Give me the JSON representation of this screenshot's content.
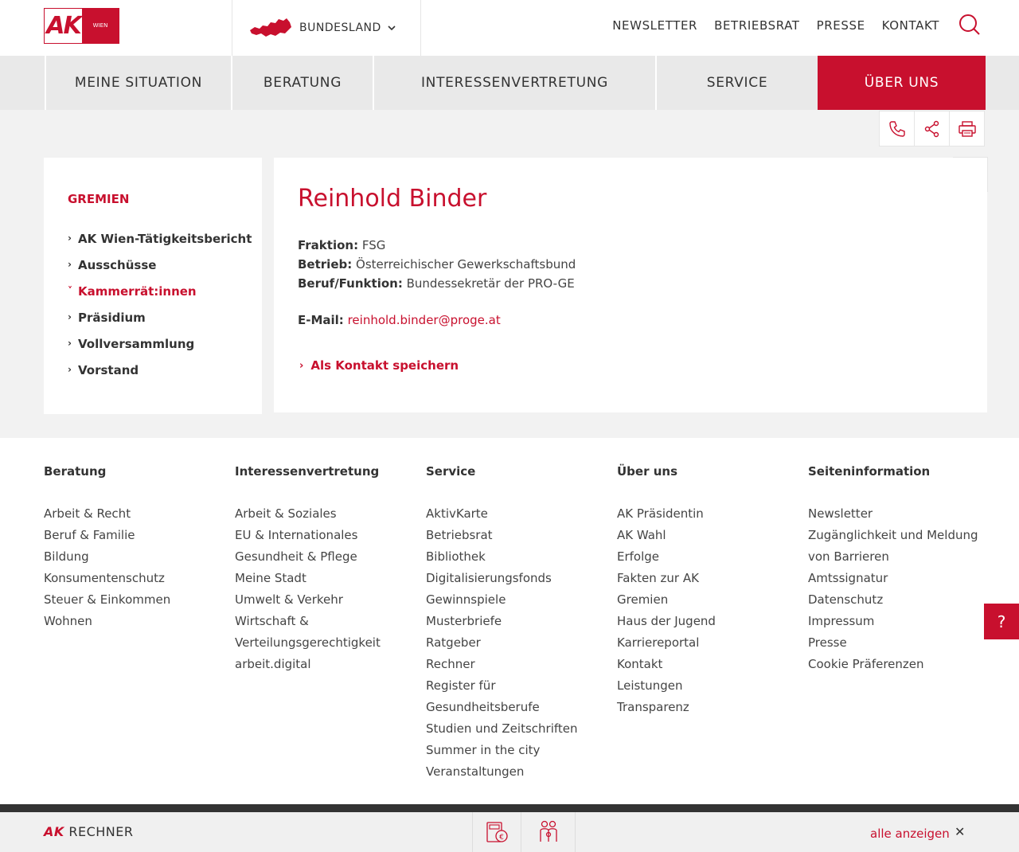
{
  "header": {
    "logo": {
      "ak": "AK",
      "wien": "WIEN"
    },
    "bundesland_label": "BUNDESLAND",
    "top_links": [
      "NEWSLETTER",
      "BETRIEBSRAT",
      "PRESSE",
      "KONTAKT"
    ]
  },
  "main_nav": {
    "items": [
      "MEINE SITUATION",
      "BERATUNG",
      "INTERESSENVERTRETUNG",
      "SERVICE",
      "ÜBER UNS"
    ],
    "active": "ÜBER UNS"
  },
  "sidebar": {
    "title": "GREMIEN",
    "items": [
      {
        "label": "AK Wien-Tätigkeitsbericht",
        "active": false
      },
      {
        "label": "Ausschüsse",
        "active": false
      },
      {
        "label": "Kammerrät:innen",
        "active": true
      },
      {
        "label": "Präsidium",
        "active": false
      },
      {
        "label": "Vollversammlung",
        "active": false
      },
      {
        "label": "Vorstand",
        "active": false
      }
    ]
  },
  "profile": {
    "name": "Reinhold Binder",
    "fraktion_label": "Fraktion:",
    "fraktion": "FSG",
    "betrieb_label": "Betrieb:",
    "betrieb": "Österreichischer Gewerkschaftsbund",
    "beruf_label": "Beruf/Funktion:",
    "beruf": "Bundessekretär der PRO-GE",
    "email_label": "E-Mail:",
    "email": "reinhold.binder@proge.at",
    "save_contact": "Als Kontakt speichern"
  },
  "footer": {
    "columns": [
      {
        "title": "Beratung",
        "links": [
          "Arbeit & Recht",
          "Beruf & Familie",
          "Bildung",
          "Konsumentenschutz",
          "Steuer & Einkommen",
          "Wohnen"
        ]
      },
      {
        "title": "Interessenvertretung",
        "links": [
          "Arbeit & Soziales",
          "EU & Internationales",
          "Gesundheit & Pflege",
          "Meine Stadt",
          "Umwelt & Verkehr",
          "Wirtschaft &",
          "Verteilungsgerechtigkeit",
          "arbeit.digital"
        ]
      },
      {
        "title": "Service",
        "links": [
          "AktivKarte",
          "Betriebsrat",
          "Bibliothek",
          "Digitalisierungsfonds",
          "Gewinnspiele",
          "Musterbriefe",
          "Ratgeber",
          "Rechner",
          "Register für",
          "Gesundheitsberufe",
          "Studien und Zeitschriften",
          "Summer in the city",
          "Veranstaltungen"
        ]
      },
      {
        "title": "Über uns",
        "links": [
          "AK Präsidentin",
          "AK Wahl",
          "Erfolge",
          "Fakten zur AK",
          "Gremien",
          "Haus der Jugend",
          "Karriereportal",
          "Kontakt",
          "Leistungen",
          "Transparenz"
        ]
      },
      {
        "title": "Seiteninformation",
        "links": [
          "Newsletter",
          "Zugänglichkeit und Meldung",
          "von Barrieren",
          "Amtssignatur",
          "Datenschutz",
          "Impressum",
          "Presse",
          "Cookie Präferenzen"
        ]
      }
    ]
  },
  "help_label": "?",
  "bottom_bar": {
    "ak": "AK",
    "rechner": "RECHNER",
    "all_label": "alle anzeigen",
    "close": "✕"
  },
  "colors": {
    "accent": "#c8102e",
    "background": "#f2f2f2"
  }
}
